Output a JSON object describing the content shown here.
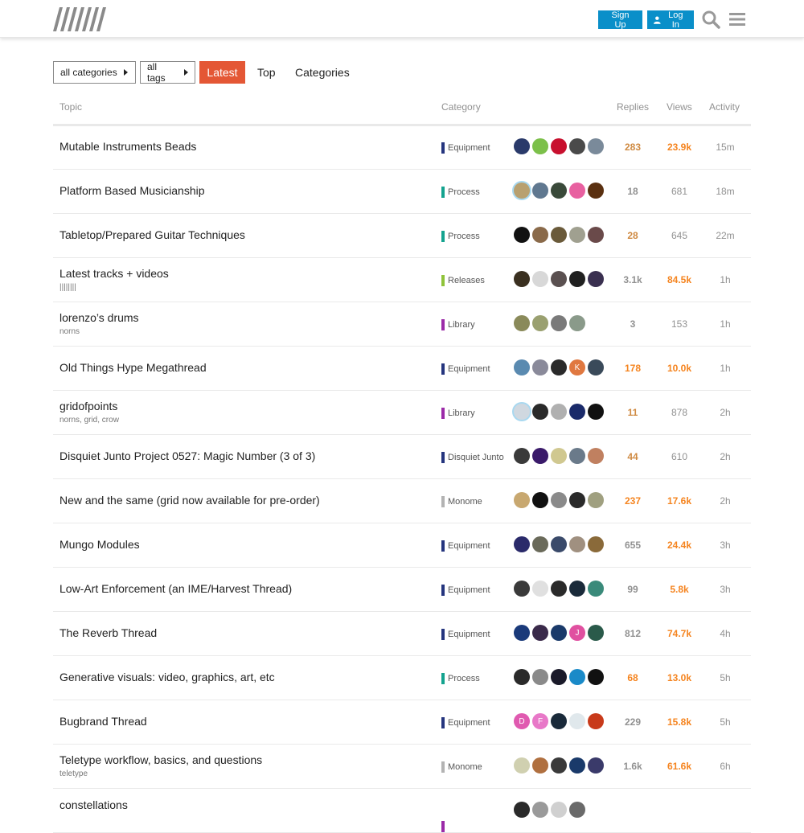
{
  "colors": {
    "accent": "#e45735",
    "primary": "#0a8fc9",
    "equipment": "#25357e",
    "process": "#14a38f",
    "releases": "#8fc33a",
    "library": "#9b2ba8",
    "junto": "#25357e",
    "monome": "#b3b3b3"
  },
  "header": {
    "signup": "Sign Up",
    "login": "Log In",
    "login_icon": "user-icon",
    "search_icon": "search-icon",
    "menu_icon": "hamburger-menu-icon"
  },
  "nav": {
    "categories": "all categories",
    "tags": "all tags",
    "latest": "Latest",
    "top": "Top",
    "cats_tab": "Categories"
  },
  "columns": {
    "topic": "Topic",
    "category": "Category",
    "replies": "Replies",
    "views": "Views",
    "activity": "Activity"
  },
  "topics": [
    {
      "title": "Mutable Instruments Beads",
      "tags": "",
      "category": "Equipment",
      "catColor": "#25357e",
      "replies": "283",
      "rc": "c-orange1",
      "views": "23.9k",
      "vc": "c-orange2",
      "activity": "15m",
      "avatars": [
        "#2a3a6a",
        "#7cc04a",
        "#c8102e",
        "#4a4a4a",
        "#7a8a9a"
      ]
    },
    {
      "title": "Platform Based Musicianship",
      "tags": "",
      "category": "Process",
      "catColor": "#14a38f",
      "replies": "18",
      "rc": "c-gray",
      "views": "681",
      "vc": "c-gray-n",
      "activity": "18m",
      "avatars": [
        "#b8a070",
        "#607890",
        "#3a4a3a",
        "#e860a0",
        "#5a3010"
      ]
    },
    {
      "title": "Tabletop/Prepared Guitar Techniques",
      "tags": "",
      "category": "Process",
      "catColor": "#14a38f",
      "replies": "28",
      "rc": "c-orange1",
      "views": "645",
      "vc": "c-gray-n",
      "activity": "22m",
      "avatars": [
        "#111111",
        "#8a6a4a",
        "#6a5a3a",
        "#a0a090",
        "#6a4a4a"
      ]
    },
    {
      "title": "Latest tracks + videos",
      "tags": "||||||||",
      "category": "Releases",
      "catColor": "#8fc33a",
      "replies": "3.1k",
      "rc": "c-gray",
      "views": "84.5k",
      "vc": "c-orange2",
      "activity": "1h",
      "avatars": [
        "#3a3020",
        "#d8d8d8",
        "#5a5050",
        "#202020",
        "#3a3050"
      ]
    },
    {
      "title": "lorenzo’s drums",
      "tags": "norns",
      "category": "Library",
      "catColor": "#9b2ba8",
      "replies": "3",
      "rc": "c-gray",
      "views": "153",
      "vc": "c-gray-n",
      "activity": "1h",
      "avatars": [
        "#8a8a5a",
        "#9aa070",
        "#7a7a7a",
        "#8a9a8a"
      ]
    },
    {
      "title": "Old Things Hype Megathread",
      "tags": "",
      "category": "Equipment",
      "catColor": "#25357e",
      "replies": "178",
      "rc": "c-orange2",
      "views": "10.0k",
      "vc": "c-orange2",
      "activity": "1h",
      "avatars": [
        "#5a8ab0",
        "#8a8a9a",
        "#2a2a2a",
        "#e07840",
        "#3a4a5a"
      ],
      "letters": [
        "",
        "",
        "",
        "K",
        ""
      ]
    },
    {
      "title": "gridofpoints",
      "tags": "norns,  grid,  crow",
      "category": "Library",
      "catColor": "#9b2ba8",
      "replies": "11",
      "rc": "c-orange1",
      "views": "878",
      "vc": "c-gray-n",
      "activity": "2h",
      "avatars": [
        "#d0d8e0",
        "#2a2a2a",
        "#b0b0b0",
        "#1a2a6a",
        "#111111"
      ]
    },
    {
      "title": "Disquiet Junto Project 0527: Magic Number (3 of 3)",
      "tags": "",
      "category": "Disquiet Junto",
      "catColor": "#25357e",
      "replies": "44",
      "rc": "c-orange1",
      "views": "610",
      "vc": "c-gray-n",
      "activity": "2h",
      "avatars": [
        "#3a3a3a",
        "#3a1a6a",
        "#d0c890",
        "#6a7a8a",
        "#c08060"
      ]
    },
    {
      "title": "New and the same (grid now available for pre-order)",
      "tags": "",
      "category": "Monome",
      "catColor": "#b3b3b3",
      "replies": "237",
      "rc": "c-orange2",
      "views": "17.6k",
      "vc": "c-orange2",
      "activity": "2h",
      "avatars": [
        "#c8a870",
        "#111111",
        "#8a8a8a",
        "#2a2a2a",
        "#a0a080"
      ]
    },
    {
      "title": "Mungo Modules",
      "tags": "",
      "category": "Equipment",
      "catColor": "#25357e",
      "replies": "655",
      "rc": "c-gray",
      "views": "24.4k",
      "vc": "c-orange2",
      "activity": "3h",
      "avatars": [
        "#2a2a6a",
        "#6a6a5a",
        "#3a4a6a",
        "#a09080",
        "#8a6a3a"
      ]
    },
    {
      "title": "Low-Art Enforcement (an IME/Harvest Thread)",
      "tags": "",
      "category": "Equipment",
      "catColor": "#25357e",
      "replies": "99",
      "rc": "c-gray",
      "views": "5.8k",
      "vc": "c-orange2",
      "activity": "3h",
      "avatars": [
        "#3a3a3a",
        "#e0e0e0",
        "#2a2a2a",
        "#1a2a3a",
        "#3a8a7a"
      ]
    },
    {
      "title": "The Reverb Thread",
      "tags": "",
      "category": "Equipment",
      "catColor": "#25357e",
      "replies": "812",
      "rc": "c-gray",
      "views": "74.7k",
      "vc": "c-orange2",
      "activity": "4h",
      "avatars": [
        "#1a3a7a",
        "#3a2a4a",
        "#1a3a6a",
        "#e050a0",
        "#2a5a4a"
      ],
      "letters": [
        "",
        "",
        "",
        "J",
        ""
      ]
    },
    {
      "title": "Generative visuals: video, graphics, art, etc",
      "tags": "",
      "category": "Process",
      "catColor": "#14a38f",
      "replies": "68",
      "rc": "c-orange2",
      "views": "13.0k",
      "vc": "c-orange2",
      "activity": "5h",
      "avatars": [
        "#2a2a2a",
        "#8a8a8a",
        "#1a1a2a",
        "#1a8ac8",
        "#111111"
      ]
    },
    {
      "title": "Bugbrand Thread",
      "tags": "",
      "category": "Equipment",
      "catColor": "#25357e",
      "replies": "229",
      "rc": "c-gray",
      "views": "15.8k",
      "vc": "c-orange2",
      "activity": "5h",
      "avatars": [
        "#e05ab0",
        "#e878c8",
        "#1a2a3a",
        "#e0e8ec",
        "#c83a1a"
      ],
      "letters": [
        "D",
        "F",
        "",
        "",
        ""
      ]
    },
    {
      "title": "Teletype workflow, basics, and questions",
      "tags": "teletype",
      "category": "Monome",
      "catColor": "#b3b3b3",
      "replies": "1.6k",
      "rc": "c-gray",
      "views": "61.6k",
      "vc": "c-orange2",
      "activity": "6h",
      "avatars": [
        "#d0d0b0",
        "#b07040",
        "#3a3a3a",
        "#1a3a6a",
        "#3a3a6a"
      ]
    },
    {
      "title": "constellations",
      "tags": "",
      "category": "",
      "catColor": "#9b2ba8",
      "replies": "",
      "rc": "c-gray",
      "views": "",
      "vc": "c-gray-n",
      "activity": "",
      "avatars": [
        "#2a2a2a",
        "#9a9a9a",
        "#d0d0d0",
        "#6a6a6a"
      ]
    }
  ]
}
